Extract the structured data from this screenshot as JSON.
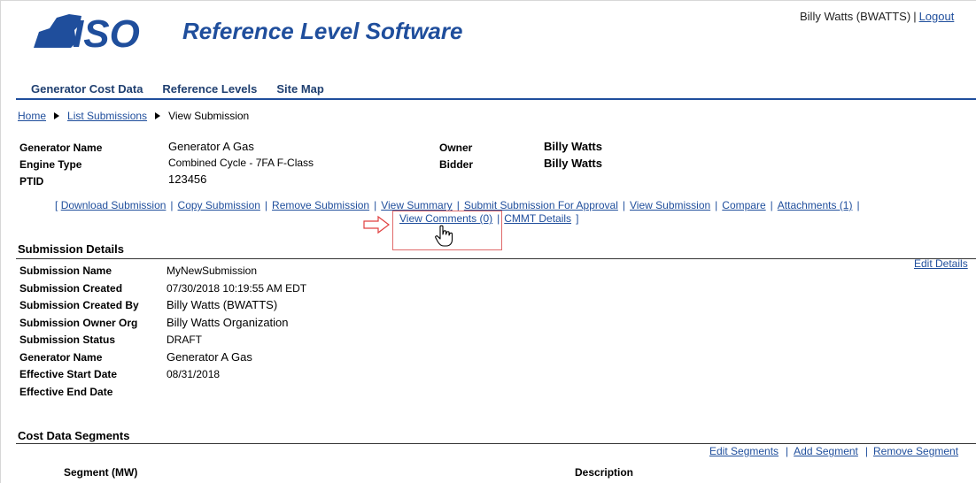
{
  "header": {
    "logo_text": "ISO",
    "app_title": "Reference Level Software",
    "user": "Billy Watts (BWATTS)",
    "sep": "|",
    "logout": "Logout"
  },
  "nav": [
    "Generator Cost Data",
    "Reference Levels",
    "Site Map"
  ],
  "breadcrumb": [
    "Home",
    "List Submissions",
    "View Submission"
  ],
  "generator": {
    "name_label": "Generator Name",
    "name_value": "Generator A Gas",
    "engine_label": "Engine Type",
    "engine_value": "Combined Cycle - 7FA F-Class",
    "ptid_label": "PTID",
    "ptid_value": "123456",
    "owner_label": "Owner",
    "owner_value": "Billy Watts",
    "bidder_label": "Bidder",
    "bidder_value": "Billy Watts"
  },
  "actions": {
    "open": "[",
    "close": "]",
    "pipe": "|",
    "links": [
      "Download Submission",
      "Copy Submission",
      "Remove Submission",
      "View Summary",
      "Submit Submission For Approval",
      "View Submission",
      "Compare",
      "Attachments (1)"
    ],
    "view_comments": "View Comments (0)",
    "cmmt": "CMMT Details"
  },
  "submission": {
    "title": "Submission Details",
    "edit": "Edit Details",
    "rows": [
      {
        "label": "Submission Name",
        "value": "MyNewSubmission"
      },
      {
        "label": "Submission Created",
        "value": "07/30/2018 10:19:55 AM EDT"
      },
      {
        "label": "Submission Created By",
        "value": "Billy Watts (BWATTS)"
      },
      {
        "label": "Submission Owner Org",
        "value": "Billy Watts Organization"
      },
      {
        "label": "Submission Status",
        "value": "DRAFT"
      },
      {
        "label": "Generator Name",
        "value": "Generator A Gas"
      },
      {
        "label": "Effective Start Date",
        "value": "08/31/2018"
      },
      {
        "label": "Effective End Date",
        "value": ""
      }
    ]
  },
  "segments": {
    "title": "Cost Data Segments",
    "edit": "Edit Segments",
    "add": "Add Segment",
    "remove": "Remove Segment",
    "pipe": "|",
    "col1": "Segment (MW)",
    "col2": "Description"
  }
}
